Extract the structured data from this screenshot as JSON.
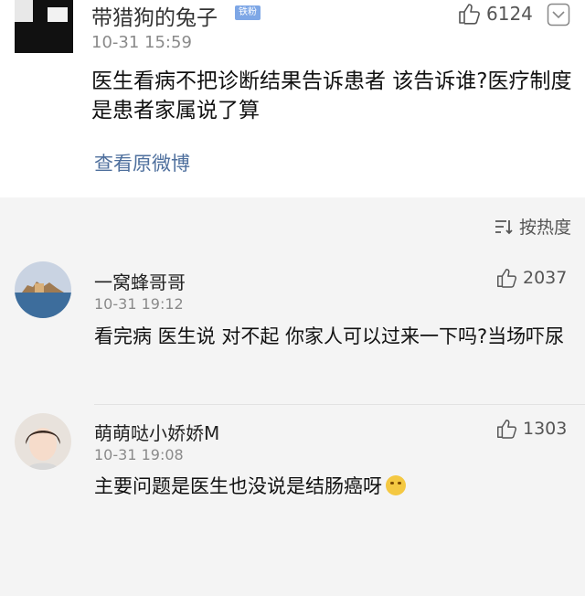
{
  "post": {
    "author": "带猎狗的兔子",
    "badge": "铁粉",
    "time": "10-31 15:59",
    "likes": "6124",
    "text": "医生看病不把诊断结果告诉患者  该告诉谁?医疗制度是患者家属说了算",
    "view_original": "查看原微博"
  },
  "sort": {
    "label": "按热度"
  },
  "comments": [
    {
      "author": "一窝蜂哥哥",
      "time": "10-31 19:12",
      "likes": "2037",
      "text": "看完病 医生说 对不起 你家人可以过来一下吗?当场吓尿"
    },
    {
      "author": "萌萌哒小娇娇M",
      "time": "10-31 19:08",
      "likes": "1303",
      "text": "主要问题是医生也没说是结肠癌呀"
    }
  ],
  "icons": {
    "like": "thumbs-up-icon",
    "more": "chevron-down-icon",
    "sort": "sort-icon",
    "emoji": "crying-laughing-emoji-icon"
  },
  "colors": {
    "link": "#4e6f9d",
    "badge": "#7ea7e6"
  }
}
